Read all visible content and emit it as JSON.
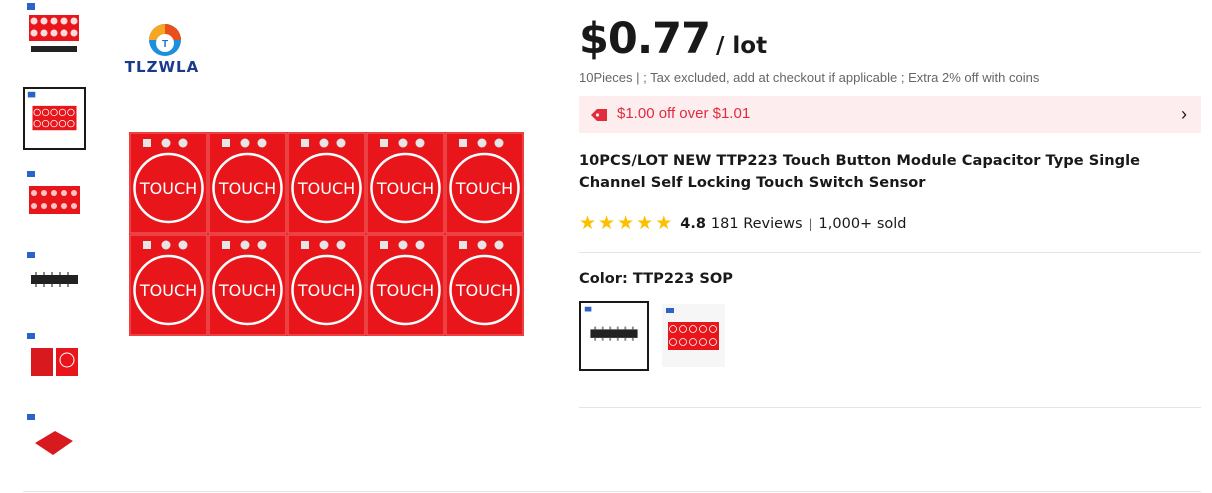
{
  "gallery": {
    "thumbnails": [
      {
        "name": "thumb-touch-boards-with-chips",
        "selected": false
      },
      {
        "name": "thumb-touch-boards-front",
        "selected": true
      },
      {
        "name": "thumb-touch-boards-grid",
        "selected": false
      },
      {
        "name": "thumb-ttp223-sop-chip",
        "selected": false
      },
      {
        "name": "thumb-single-module",
        "selected": false
      },
      {
        "name": "thumb-module-angled",
        "selected": false
      }
    ],
    "brand_logo_text": "TLZWLA",
    "pad_label": "TOUCH"
  },
  "product": {
    "price": "$0.77",
    "unit": "/ lot",
    "subnote": "10Pieces | ; Tax excluded, add at checkout if applicable ; Extra 2% off with coins",
    "promo": "$1.00 off over $1.01",
    "title": "10PCS/LOT NEW TTP223 Touch Button Module Capacitor Type Single Channel Self Locking Touch Switch Sensor",
    "rating": {
      "stars": 5,
      "score": "4.8",
      "reviews": "181 Reviews",
      "sold": "1,000+ sold"
    },
    "color": {
      "label": "Color: TTP223 SOP",
      "options": [
        {
          "name": "TTP223 SOP",
          "selected": true
        },
        {
          "name": "touch module",
          "selected": false
        }
      ]
    }
  },
  "colors": {
    "accent_red": "#e02c3c",
    "pcb_red": "#e8161b",
    "star": "#fdc001",
    "promo_bg": "#fdedef"
  }
}
